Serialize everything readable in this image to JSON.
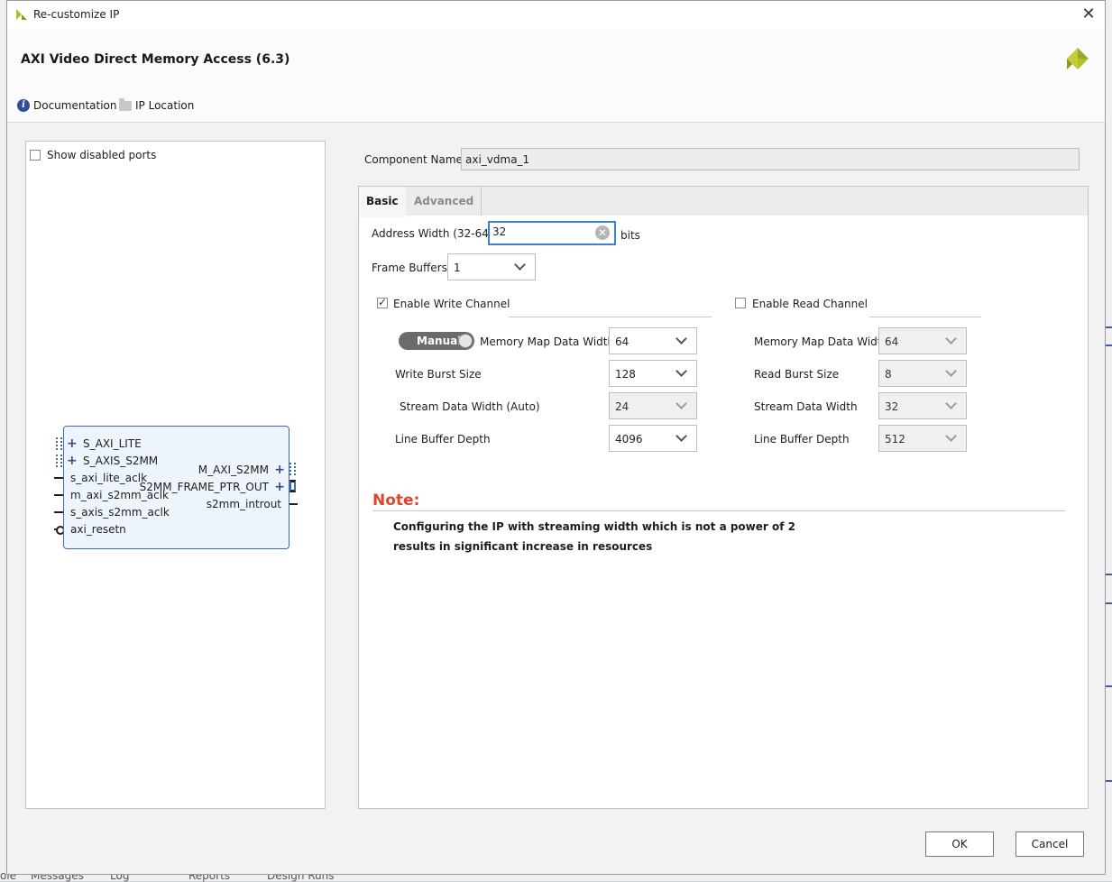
{
  "window": {
    "title": "Re-customize IP",
    "close_glyph": "✕",
    "logo_icon": "xilinx-logo-icon"
  },
  "header": {
    "ip_title": "AXI Video Direct Memory Access (6.3)"
  },
  "links": {
    "documentation": "Documentation",
    "ip_location": "IP Location"
  },
  "left_panel": {
    "show_disabled_ports": "Show disabled ports",
    "show_disabled_checked": false,
    "block": {
      "left_ports": [
        "S_AXI_LITE",
        "S_AXIS_S2MM",
        "s_axi_lite_aclk",
        "m_axi_s2mm_aclk",
        "s_axis_s2mm_aclk",
        "axi_resetn"
      ],
      "right_ports": [
        "M_AXI_S2MM",
        "S2MM_FRAME_PTR_OUT",
        "s2mm_introut"
      ]
    }
  },
  "component": {
    "label": "Component Name",
    "value": "axi_vdma_1"
  },
  "tabs": {
    "basic": "Basic",
    "advanced": "Advanced"
  },
  "basic": {
    "address_width_label": "Address Width (32-64)",
    "address_width_value": "32",
    "address_width_unit": "bits",
    "frame_buffers_label": "Frame Buffers",
    "frame_buffers_value": "1",
    "write": {
      "enable_label": "Enable Write Channel",
      "enabled": true,
      "toggle_label": "Manual",
      "mm_data_width_label": "Memory Map Data Width",
      "mm_data_width_value": "64",
      "burst_label": "Write Burst Size",
      "burst_value": "128",
      "stream_label": "Stream Data Width (Auto)",
      "stream_value": "24",
      "line_buffer_label": "Line Buffer Depth",
      "line_buffer_value": "4096"
    },
    "read": {
      "enable_label": "Enable Read Channel",
      "enabled": false,
      "mm_data_width_label": "Memory Map Data Width",
      "mm_data_width_value": "64",
      "burst_label": "Read Burst Size",
      "burst_value": "8",
      "stream_label": "Stream Data Width",
      "stream_value": "32",
      "line_buffer_label": "Line Buffer Depth",
      "line_buffer_value": "512"
    },
    "note": {
      "title": "Note:",
      "line1": "Configuring the IP with streaming width which is not a power of 2",
      "line2": "results in significant increase in resources"
    }
  },
  "buttons": {
    "ok": "OK",
    "cancel": "Cancel"
  },
  "background": {
    "bottom_tabs": [
      "ole",
      "Messages",
      "Log",
      "Reports",
      "Design Runs"
    ]
  },
  "colors": {
    "accent": "#3b82d6",
    "note": "#e0452b",
    "block_border": "#3f6aa8",
    "xilinx_logo": "#b5bd2a"
  }
}
